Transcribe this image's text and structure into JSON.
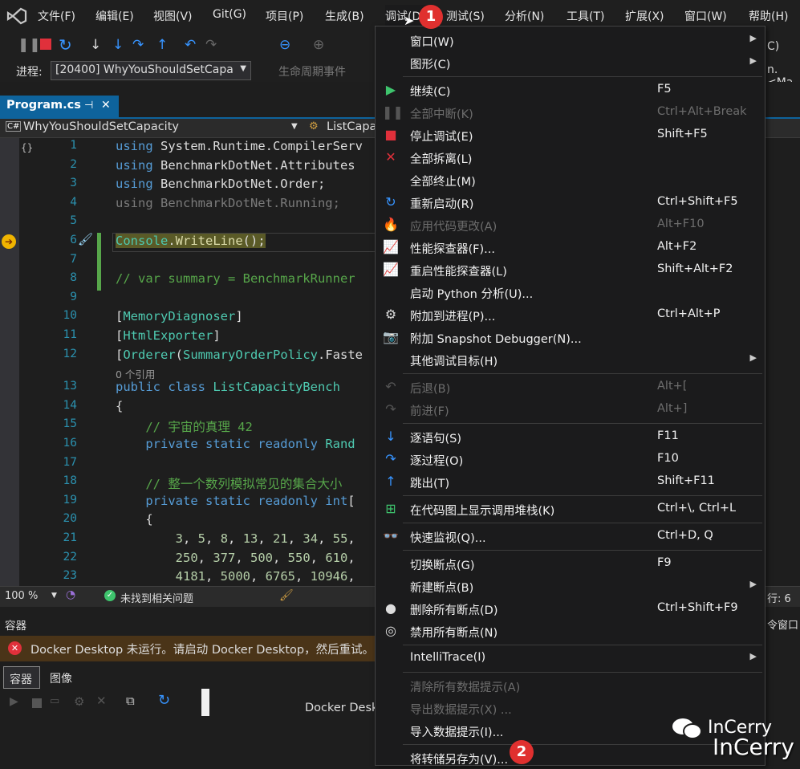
{
  "menubar": {
    "items": [
      "文件(F)",
      "编辑(E)",
      "视图(V)",
      "Git(G)",
      "项目(P)",
      "生成(B)",
      "调试(D)",
      "测试(S)",
      "分析(N)",
      "工具(T)",
      "扩展(X)",
      "窗口(W)",
      "帮助(H)"
    ]
  },
  "procbar": {
    "label": "进程:",
    "process": "[20400] WhyYouShouldSetCapa",
    "lifecycle": "生命周期事件",
    "right_text": "n.<Ma"
  },
  "toolbar": {
    "right_text": "C)"
  },
  "tab": {
    "name": "Program.cs",
    "pin": "⊣",
    "close": "✕"
  },
  "navbar": {
    "project": "WhyYouShouldSetCapacity",
    "member": "ListCapa"
  },
  "editor": {
    "lines": [
      {
        "n": "1",
        "html": "<span class='kw'>using</span> System.Runtime.CompilerServ"
      },
      {
        "n": "2",
        "html": "<span class='kw'>using</span> BenchmarkDotNet.Attributes"
      },
      {
        "n": "3",
        "html": "<span class='kw'>using</span> BenchmarkDotNet.Order;"
      },
      {
        "n": "4",
        "html": "<span class='gr'>using BenchmarkDotNet.Running;</span>"
      },
      {
        "n": "5",
        "html": ""
      },
      {
        "n": "6",
        "html": "<span style='background:#5a5a27'><span class='ty'>Console</span>.<span class='mt'>WriteLine</span>();</span>"
      },
      {
        "n": "7",
        "html": ""
      },
      {
        "n": "8",
        "html": "<span class='cm'>// var summary = BenchmarkRunner</span>"
      },
      {
        "n": "9",
        "html": ""
      },
      {
        "n": "10",
        "html": "[<span class='ty'>MemoryDiagnoser</span>]"
      },
      {
        "n": "11",
        "html": "[<span class='ty'>HtmlExporter</span>]"
      },
      {
        "n": "12",
        "html": "[<span class='ty'>Orderer</span>(<span class='ty'>SummaryOrderPolicy</span>.Faste"
      },
      {
        "n": "13",
        "html": "<span class='kw'>public class</span> <span class='ty'>ListCapacityBench</span>"
      },
      {
        "n": "14",
        "html": "{"
      },
      {
        "n": "15",
        "html": "    <span class='cm'>// 宇宙的真理 42</span>"
      },
      {
        "n": "16",
        "html": "    <span class='kw'>private static readonly</span> <span class='ty'>Rand</span>"
      },
      {
        "n": "17",
        "html": ""
      },
      {
        "n": "18",
        "html": "    <span class='cm'>// 整一个数列模拟常见的集合大小</span>"
      },
      {
        "n": "19",
        "html": "    <span class='kw'>private static readonly int</span>["
      },
      {
        "n": "20",
        "html": "    {"
      },
      {
        "n": "21",
        "html": "        <span class='nm'>3</span>, <span class='nm'>5</span>, <span class='nm'>8</span>, <span class='nm'>13</span>, <span class='nm'>21</span>, <span class='nm'>34</span>, <span class='nm'>55</span>,"
      },
      {
        "n": "22",
        "html": "        <span class='nm'>250</span>, <span class='nm'>377</span>, <span class='nm'>500</span>, <span class='nm'>550</span>, <span class='nm'>610</span>,"
      },
      {
        "n": "23",
        "html": "        <span class='nm'>4181</span>, <span class='nm'>5000</span>, <span class='nm'>6765</span>, <span class='nm'>10946</span>,"
      }
    ],
    "refs": "0 个引用"
  },
  "status": {
    "zoom": "100 %",
    "issues": "未找到相关问题",
    "right": "行: 6"
  },
  "bottom": {
    "title": "容器",
    "error": "Docker Desktop 未运行。请启动 Docker Desktop，然后重试。",
    "tab_containers": "容器",
    "tab_images": "图像",
    "center_text": "Docker Desk",
    "right_text": "令窗口"
  },
  "menu": {
    "items": [
      {
        "label": "窗口(W)",
        "shortcut": "",
        "icon": "",
        "arrow": true,
        "dis": false
      },
      {
        "label": "图形(C)",
        "shortcut": "",
        "icon": "",
        "arrow": true,
        "dis": false
      },
      {
        "sep": true
      },
      {
        "label": "继续(C)",
        "shortcut": "F5",
        "icon": "play-icon",
        "arrow": false,
        "dis": false
      },
      {
        "label": "全部中断(K)",
        "shortcut": "Ctrl+Alt+Break",
        "icon": "pause-icon",
        "arrow": false,
        "dis": true
      },
      {
        "label": "停止调试(E)",
        "shortcut": "Shift+F5",
        "icon": "stop-icon",
        "arrow": false,
        "dis": false
      },
      {
        "label": "全部拆离(L)",
        "shortcut": "",
        "icon": "detach-icon",
        "arrow": false,
        "dis": false
      },
      {
        "label": "全部终止(M)",
        "shortcut": "",
        "icon": "",
        "arrow": false,
        "dis": false
      },
      {
        "label": "重新启动(R)",
        "shortcut": "Ctrl+Shift+F5",
        "icon": "restart-icon",
        "arrow": false,
        "dis": false
      },
      {
        "label": "应用代码更改(A)",
        "shortcut": "Alt+F10",
        "icon": "hot-reload-icon",
        "arrow": false,
        "dis": true
      },
      {
        "label": "性能探查器(F)...",
        "shortcut": "Alt+F2",
        "icon": "profiler-icon",
        "arrow": false,
        "dis": false
      },
      {
        "label": "重启性能探查器(L)",
        "shortcut": "Shift+Alt+F2",
        "icon": "profiler-restart-icon",
        "arrow": false,
        "dis": false
      },
      {
        "label": "启动 Python 分析(U)...",
        "shortcut": "",
        "icon": "",
        "arrow": false,
        "dis": false
      },
      {
        "label": "附加到进程(P)...",
        "shortcut": "Ctrl+Alt+P",
        "icon": "attach-gear-icon",
        "arrow": false,
        "dis": false
      },
      {
        "label": "附加 Snapshot Debugger(N)...",
        "shortcut": "",
        "icon": "snapshot-icon",
        "arrow": false,
        "dis": false
      },
      {
        "label": "其他调试目标(H)",
        "shortcut": "",
        "icon": "",
        "arrow": true,
        "dis": false
      },
      {
        "sep": true
      },
      {
        "label": "后退(B)",
        "shortcut": "Alt+[",
        "icon": "back-icon",
        "arrow": false,
        "dis": true
      },
      {
        "label": "前进(F)",
        "shortcut": "Alt+]",
        "icon": "forward-icon",
        "arrow": false,
        "dis": true
      },
      {
        "sep": true
      },
      {
        "label": "逐语句(S)",
        "shortcut": "F11",
        "icon": "step-into-icon",
        "arrow": false,
        "dis": false
      },
      {
        "label": "逐过程(O)",
        "shortcut": "F10",
        "icon": "step-over-icon",
        "arrow": false,
        "dis": false
      },
      {
        "label": "跳出(T)",
        "shortcut": "Shift+F11",
        "icon": "step-out-icon",
        "arrow": false,
        "dis": false
      },
      {
        "sep": true
      },
      {
        "label": "在代码图上显示调用堆栈(K)",
        "shortcut": "Ctrl+\\, Ctrl+L",
        "icon": "call-stack-map-icon",
        "arrow": false,
        "dis": false
      },
      {
        "sep": true
      },
      {
        "label": "快速监视(Q)...",
        "shortcut": "Ctrl+D, Q",
        "icon": "glasses-icon",
        "arrow": false,
        "dis": false
      },
      {
        "sep": true
      },
      {
        "label": "切换断点(G)",
        "shortcut": "F9",
        "icon": "",
        "arrow": false,
        "dis": false
      },
      {
        "label": "新建断点(B)",
        "shortcut": "",
        "icon": "",
        "arrow": true,
        "dis": false
      },
      {
        "label": "删除所有断点(D)",
        "shortcut": "Ctrl+Shift+F9",
        "icon": "delete-breakpoints-icon",
        "arrow": false,
        "dis": false
      },
      {
        "label": "禁用所有断点(N)",
        "shortcut": "",
        "icon": "disable-breakpoints-icon",
        "arrow": false,
        "dis": false
      },
      {
        "sep": true
      },
      {
        "label": "IntelliTrace(I)",
        "shortcut": "",
        "icon": "",
        "arrow": true,
        "dis": false
      },
      {
        "sep": true
      },
      {
        "label": "清除所有数据提示(A)",
        "shortcut": "",
        "icon": "",
        "arrow": false,
        "dis": true
      },
      {
        "label": "导出数据提示(X) ...",
        "shortcut": "",
        "icon": "",
        "arrow": false,
        "dis": true
      },
      {
        "label": "导入数据提示(I)...",
        "shortcut": "",
        "icon": "",
        "arrow": false,
        "dis": false
      },
      {
        "sep": true
      },
      {
        "label": "将转储另存为(V)...",
        "shortcut": "",
        "icon": "",
        "arrow": false,
        "dis": false
      }
    ]
  },
  "badges": [
    "1",
    "2"
  ],
  "watermark": {
    "line1": "InCerry",
    "line2": "InCerry"
  },
  "colors": {
    "accent": "#0e639c",
    "badge": "#e0302f",
    "play": "#3ec46d",
    "stop": "#e0303b"
  }
}
